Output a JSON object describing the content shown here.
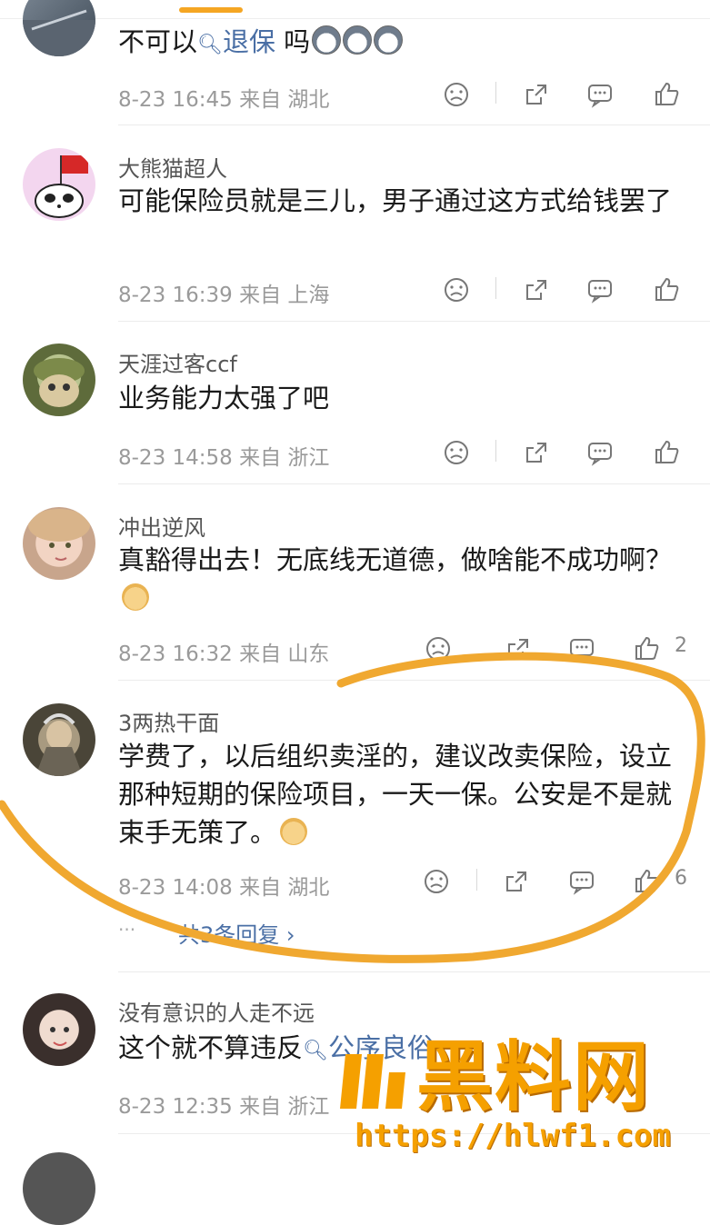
{
  "comments": [
    {
      "username": "",
      "content_text": "不可以",
      "content_link": "退保",
      "content_tail": " 吗",
      "meta": "8-23 16:45 来自 湖北",
      "like_count": ""
    },
    {
      "username": "大熊猫超人",
      "content_text": "可能保险员就是三儿，男子通过这方式给钱罢了",
      "meta": "8-23 16:39 来自 上海",
      "like_count": ""
    },
    {
      "username": "天涯过客ccf",
      "content_text": "业务能力太强了吧",
      "meta": "8-23 14:58 来自 浙江",
      "like_count": ""
    },
    {
      "username": "冲出逆风",
      "content_text": "真豁得出去！无底线无道德，做啥能不成功啊？",
      "meta": "8-23 16:32 来自 山东",
      "like_count": "2"
    },
    {
      "username": "3两热干面",
      "content_text": "学费了，以后组织卖淫的，建议改卖保险，设立那种短期的保险项目，一天一保。公安是不是就束手无策了。",
      "meta": "8-23 14:08 来自 湖北",
      "like_count": "6",
      "replies_link": "共3条回复 ›"
    },
    {
      "username": "没有意识的人走不远",
      "content_text": "这个就不算违反",
      "content_link": "公序良俗",
      "meta": "8-23 12:35 来自 浙江",
      "like_count": ""
    }
  ],
  "watermark": {
    "title": "黑料网",
    "url": "https://hlwf1.com"
  },
  "colors": {
    "accent": "#f5a623",
    "link": "#4a6fa5",
    "meta": "#9a9a9a",
    "watermark": "#f5a000"
  }
}
